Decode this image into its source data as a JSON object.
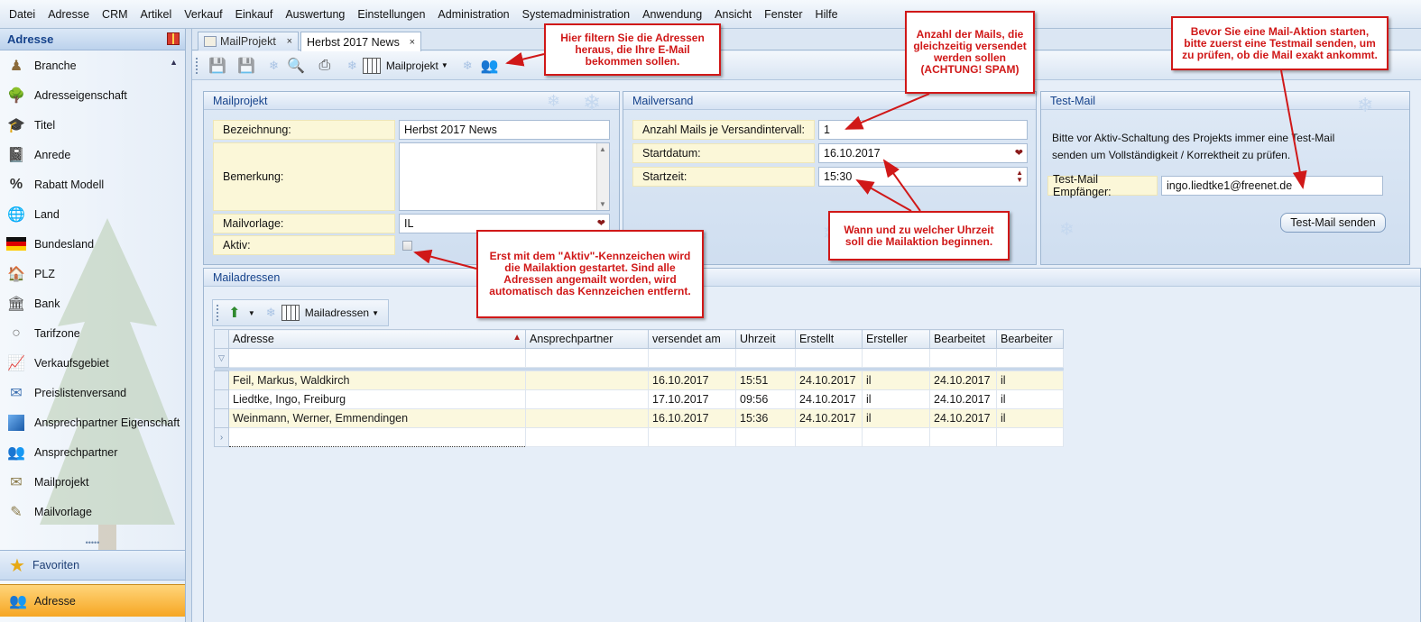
{
  "menu": [
    "Datei",
    "Adresse",
    "CRM",
    "Artikel",
    "Verkauf",
    "Einkauf",
    "Auswertung",
    "Einstellungen",
    "Administration",
    "Systemadministration",
    "Anwendung",
    "Ansicht",
    "Fenster",
    "Hilfe"
  ],
  "sidebar": {
    "title": "Adresse",
    "items": [
      {
        "label": "Branche",
        "icon": "person-icon"
      },
      {
        "label": "Adresseigenschaft",
        "icon": "tree-icon"
      },
      {
        "label": "Titel",
        "icon": "graduate-icon"
      },
      {
        "label": "Anrede",
        "icon": "contacts-book-icon"
      },
      {
        "label": "Rabatt Modell",
        "icon": "percent-icon"
      },
      {
        "label": "Land",
        "icon": "globe-icon"
      },
      {
        "label": "Bundesland",
        "icon": "german-flag-icon"
      },
      {
        "label": "PLZ",
        "icon": "houses-icon"
      },
      {
        "label": "Bank",
        "icon": "bank-icon"
      },
      {
        "label": "Tarifzone",
        "icon": "coin-icon"
      },
      {
        "label": "Verkaufsgebiet",
        "icon": "chart-board-icon"
      },
      {
        "label": "Preislistenversand",
        "icon": "envelope-info-icon"
      },
      {
        "label": "Ansprechpartner Eigenschaft",
        "icon": "blue-cube-icon"
      },
      {
        "label": "Ansprechpartner",
        "icon": "people-icon"
      },
      {
        "label": "Mailprojekt",
        "icon": "envelope-icon"
      },
      {
        "label": "Mailvorlage",
        "icon": "envelope-edit-icon"
      }
    ],
    "favorites_label": "Favoriten",
    "active_label": "Adresse"
  },
  "tabs": [
    {
      "label": "MailProjekt",
      "close": "×"
    },
    {
      "label": "Herbst 2017 News",
      "close": "×"
    }
  ],
  "toolbar": {
    "dropdown_label": "Mailprojekt"
  },
  "mailprojekt": {
    "title": "Mailprojekt",
    "bezeichnung_label": "Bezeichnung:",
    "bezeichnung_value": "Herbst 2017 News",
    "bemerkung_label": "Bemerkung:",
    "bemerkung_value": "",
    "mailvorlage_label": "Mailvorlage:",
    "mailvorlage_value": "IL",
    "aktiv_label": "Aktiv:",
    "aktiv_checked": false
  },
  "mailversand": {
    "title": "Mailversand",
    "anzahl_label": "Anzahl Mails je Versandintervall:",
    "anzahl_value": "1",
    "startdatum_label": "Startdatum:",
    "startdatum_value": "16.10.2017",
    "startzeit_label": "Startzeit:",
    "startzeit_value": "15:30"
  },
  "testmail": {
    "title": "Test-Mail",
    "hint_line1": "Bitte vor Aktiv-Schaltung des Projekts immer eine Test-Mail",
    "hint_line2": "senden um Vollständigkeit / Korrektheit  zu prüfen.",
    "empfaenger_label": "Test-Mail Empfänger:",
    "empfaenger_value": "ingo.liedtke1@freenet.de",
    "button_label": "Test-Mail senden"
  },
  "mailadressen": {
    "title": "Mailadressen",
    "toolbar_dropdown": "Mailadressen",
    "columns": [
      "Adresse",
      "Ansprechpartner",
      "versendet am",
      "Uhrzeit",
      "Erstellt",
      "Ersteller",
      "Bearbeitet",
      "Bearbeiter"
    ],
    "rows": [
      [
        "Feil, Markus, Waldkirch",
        "",
        "16.10.2017",
        "15:51",
        "24.10.2017",
        "il",
        "24.10.2017",
        "il"
      ],
      [
        "Liedtke, Ingo, Freiburg",
        "",
        "17.10.2017",
        "09:56",
        "24.10.2017",
        "il",
        "24.10.2017",
        "il"
      ],
      [
        "Weinmann, Werner, Emmendingen",
        "",
        "16.10.2017",
        "15:36",
        "24.10.2017",
        "il",
        "24.10.2017",
        "il"
      ]
    ]
  },
  "callouts": {
    "filter": "Hier filtern Sie die Adressen heraus, die Ihre E-Mail bekommen sollen.",
    "anzahl": "Anzahl der Mails, die gleichzeitig versendet werden sollen (ACHTUNG! SPAM)",
    "testmail": "Bevor Sie eine Mail-Aktion starten, bitte zuerst eine Testmail senden, um zu prüfen, ob die Mail exakt ankommt.",
    "aktiv": "Erst mit dem \"Aktiv\"-Kennzeichen wird die Mailaktion gestartet. Sind alle Adressen angemailt worden, wird automatisch das Kennzeichen entfernt.",
    "uhrzeit": "Wann und zu welcher Uhrzeit soll die Mailaktion beginnen."
  },
  "colors": {
    "accent": "#15428b",
    "callout": "#d01818",
    "field_label_bg": "#fbf7d8",
    "active_nav": "#f6a623"
  }
}
